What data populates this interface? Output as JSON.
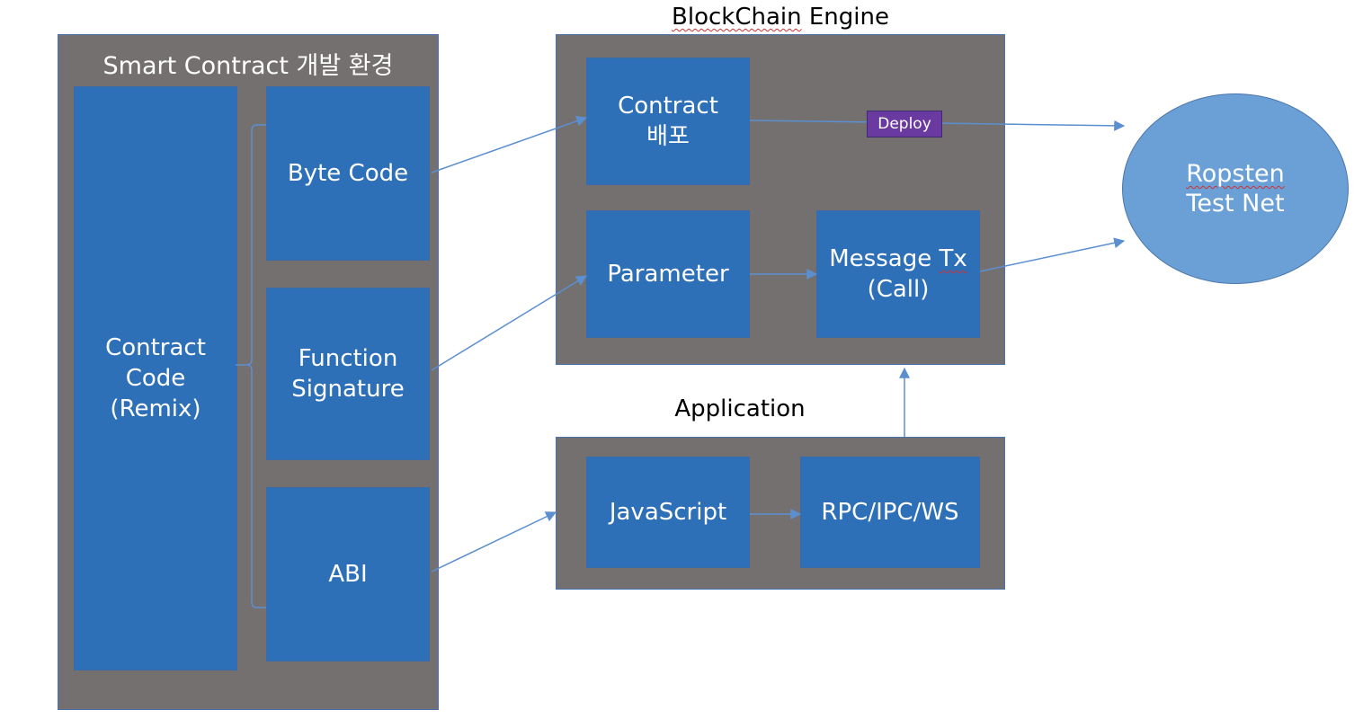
{
  "smart_contract_env": {
    "title": "Smart Contract 개발 환경",
    "contract_code": "Contract\nCode\n(Remix)",
    "byte_code": "Byte Code",
    "function_signature": "Function\nSignature",
    "abi": "ABI"
  },
  "blockchain_engine": {
    "title": "BlockChain Engine",
    "contract_deploy": "Contract\n배포",
    "parameter": "Parameter",
    "message_tx_line1": "Message Tx",
    "message_tx_line2": "(Call)",
    "deploy_label": "Deploy"
  },
  "application": {
    "title": "Application",
    "javascript": "JavaScript",
    "rpc": "RPC/IPC/WS"
  },
  "network": {
    "line1": "Ropsten",
    "line2": "Test Net"
  },
  "colors": {
    "panel_bg": "#757070",
    "box_fill": "#2e70b8",
    "connector": "#5b8fd0",
    "deploy_badge": "#6a3aa0",
    "network_fill": "#6aa0d6"
  }
}
